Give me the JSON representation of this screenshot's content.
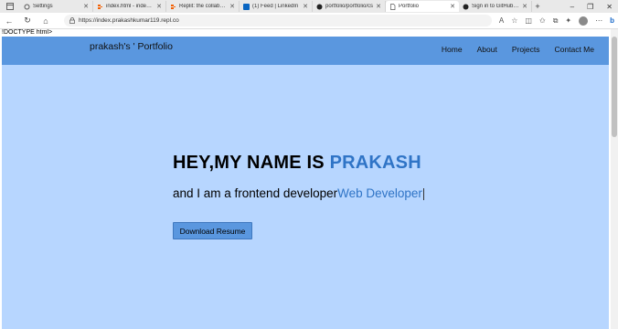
{
  "browser": {
    "tabs": [
      {
        "title": "Settings",
        "icon": "gear-icon",
        "active": false
      },
      {
        "title": "index.html - index - R",
        "icon": "replit-icon",
        "active": false
      },
      {
        "title": "Replit: the collaborati",
        "icon": "replit-icon",
        "active": false
      },
      {
        "title": "(1) Feed | LinkedIn",
        "icon": "linkedin-icon",
        "active": false
      },
      {
        "title": "portfolio/portfolio/cs",
        "icon": "github-icon",
        "active": false
      },
      {
        "title": "Portfolio",
        "icon": "page-icon",
        "active": true
      },
      {
        "title": "Sign in to GitHub · Gi",
        "icon": "github-icon",
        "active": false
      }
    ],
    "url": "https://index.prakashkumar119.repl.co"
  },
  "page": {
    "doctype_text": "!DOCTYPE html>",
    "brand": "prakash's ' Portfolio",
    "nav": [
      "Home",
      "About",
      "Projects",
      "Contact Me"
    ],
    "headline_prefix": "HEY,MY NAME IS ",
    "headline_name": "PRAKASH",
    "subline_prefix": "and I am a frontend developer",
    "subline_typed": "Web Developer",
    "resume_button": "Download Resume"
  },
  "colors": {
    "nav_bg": "#5a97df",
    "hero_bg": "#b7d6ff",
    "accent": "#2f74c6"
  }
}
